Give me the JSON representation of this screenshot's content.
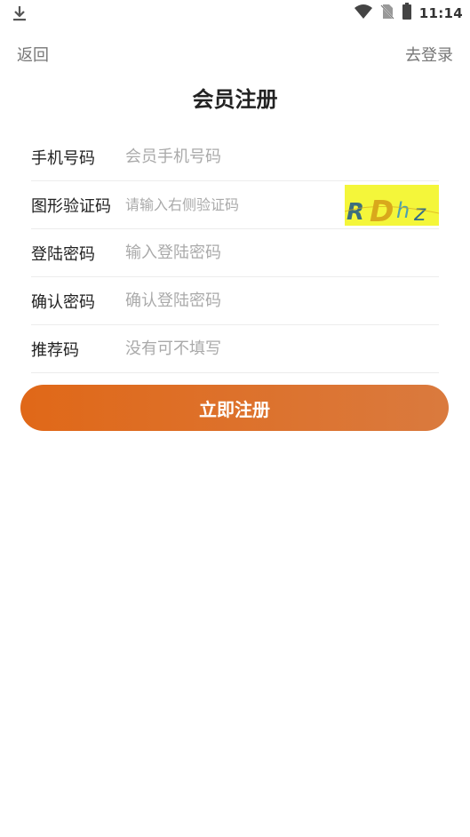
{
  "status_bar": {
    "time": "11:14",
    "icons": [
      "download-icon",
      "wifi-icon",
      "no-sim-icon",
      "battery-icon"
    ]
  },
  "nav": {
    "back_label": "返回",
    "login_label": "去登录"
  },
  "page": {
    "title": "会员注册"
  },
  "form": {
    "phone": {
      "label": "手机号码",
      "placeholder": "会员手机号码"
    },
    "captcha": {
      "label": "图形验证码",
      "placeholder": "请输入右侧验证码",
      "image_text": "RDhz"
    },
    "password": {
      "label": "登陆密码",
      "placeholder": "输入登陆密码"
    },
    "confirm": {
      "label": "确认密码",
      "placeholder": "确认登陆密码"
    },
    "referral": {
      "label": "推荐码",
      "placeholder": "没有可不填写"
    }
  },
  "submit": {
    "label": "立即注册"
  },
  "colors": {
    "accent_start": "#e06818",
    "accent_end": "#da7a3e",
    "captcha_bg": "#f4f63a"
  }
}
